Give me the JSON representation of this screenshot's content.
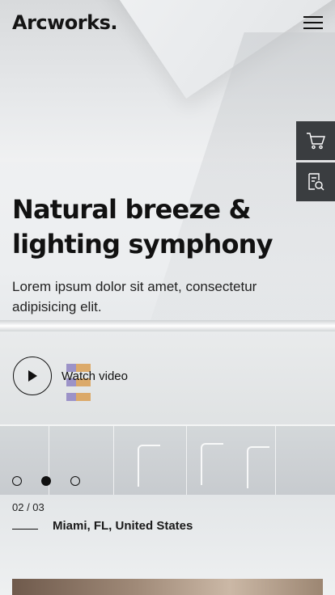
{
  "brand": {
    "logo": "Arcworks."
  },
  "header": {
    "menu_icon": "hamburger-menu-icon"
  },
  "side_actions": [
    {
      "name": "cart",
      "icon": "shopping-cart-icon"
    },
    {
      "name": "catalog",
      "icon": "catalog-search-icon"
    }
  ],
  "hero": {
    "title": "Natural breeze & lighting symphony",
    "subtitle": "Lorem ipsum dolor sit amet, consectetur adipisicing elit.",
    "video_label": "Watch video",
    "play_icon": "play-icon"
  },
  "slider": {
    "counter": "02 / 03",
    "total": 3,
    "active_index": 2,
    "location": "Miami, FL, United States"
  },
  "colors": {
    "text": "#111111",
    "side_button_bg": "#3a3d40"
  }
}
